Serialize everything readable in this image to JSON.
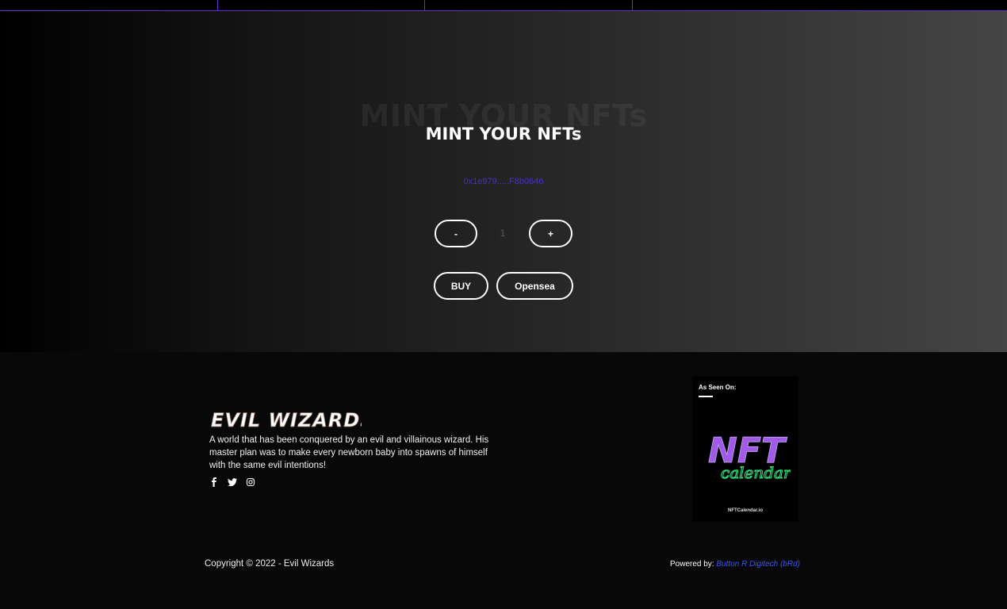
{
  "mint": {
    "ghost_title": "MINT YOUR NFTs",
    "title": "MINT YOUR NFTs",
    "wallet_address": "0x1e979.....F8b0646",
    "minus_label": "-",
    "plus_label": "+",
    "quantity": "1",
    "buy_label": "BUY",
    "opensea_label": "Opensea"
  },
  "footer": {
    "logo_text": "EVIL WIZARDS",
    "description": "A world that has been conquered by an evil and villainous wizard. His master plan was to make every newborn baby into spawns of himself with the same evil intentions!",
    "socials": [
      "facebook-icon",
      "twitter-icon",
      "instagram-icon"
    ],
    "badge": {
      "label": "As Seen On:",
      "art_line1": "NFT",
      "art_line2": "calendar",
      "url": "NFTCalendar.io"
    },
    "copyright": "Copyright © 2022 - Evil Wizards",
    "powered_label": "Powered by:",
    "powered_link": "Button R Digitech (bRd)"
  },
  "colors": {
    "accent_purple": "#6a2ad8",
    "wallet_text": "#4b2bd9",
    "link_blue": "#3a56ff"
  }
}
